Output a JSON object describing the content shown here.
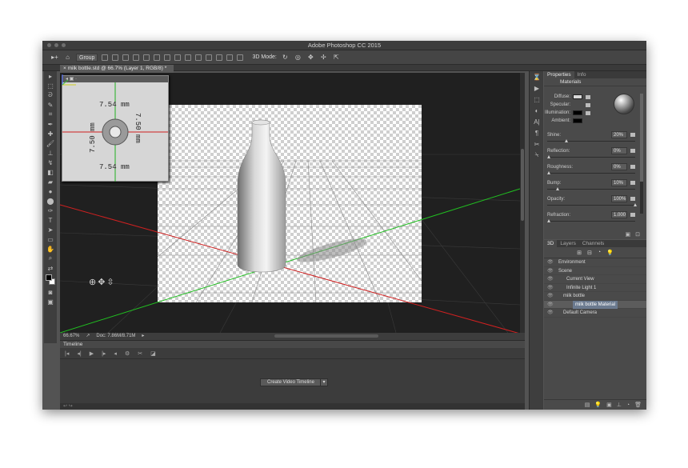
{
  "app": {
    "title": "Adobe Photoshop CC 2015"
  },
  "options_bar": {
    "group_select": "Group",
    "mode_label": "3D Mode:"
  },
  "document": {
    "tab_title": "milk bottle.std @ 66.7% (Layer 1, RGB/8) *"
  },
  "secondary_view": {
    "dim_top": "7.54 mm",
    "dim_bottom": "7.54 mm",
    "dim_left": "7.50 mm",
    "dim_right": "7.50 mm"
  },
  "status": {
    "zoom": "66.67%",
    "doc": "Doc: 7.86M/8.71M"
  },
  "timeline": {
    "title": "Timeline",
    "create_button": "Create Video Timeline"
  },
  "properties": {
    "tabs": [
      "Properties",
      "Info"
    ],
    "section": "Materials",
    "diffuse_label": "Diffuse:",
    "specular_label": "Specular:",
    "illumination_label": "Illumination:",
    "ambient_label": "Ambient:",
    "sliders": [
      {
        "label": "Shine:",
        "value": "20%",
        "pos": 0.2
      },
      {
        "label": "Reflection:",
        "value": "0%",
        "pos": 0
      },
      {
        "label": "Roughness:",
        "value": "0%",
        "pos": 0
      },
      {
        "label": "Bump:",
        "value": "10%",
        "pos": 0.1
      },
      {
        "label": "Opacity:",
        "value": "100%",
        "pos": 1
      },
      {
        "label": "Refraction:",
        "value": "1.000",
        "pos": 0
      }
    ],
    "colors": {
      "diffuse": "#d8d8d8",
      "specular": "#111111",
      "illumination": "#000000",
      "ambient": "#000000"
    }
  },
  "layers_panel": {
    "tabs": [
      "3D",
      "Layers",
      "Channels"
    ],
    "items": [
      {
        "name": "Environment"
      },
      {
        "name": "Scene"
      },
      {
        "name": "Current View"
      },
      {
        "name": "Infinite Light 1"
      },
      {
        "name": "milk bottle"
      },
      {
        "name": "milk bottle Material"
      },
      {
        "name": "Default Camera"
      }
    ]
  }
}
